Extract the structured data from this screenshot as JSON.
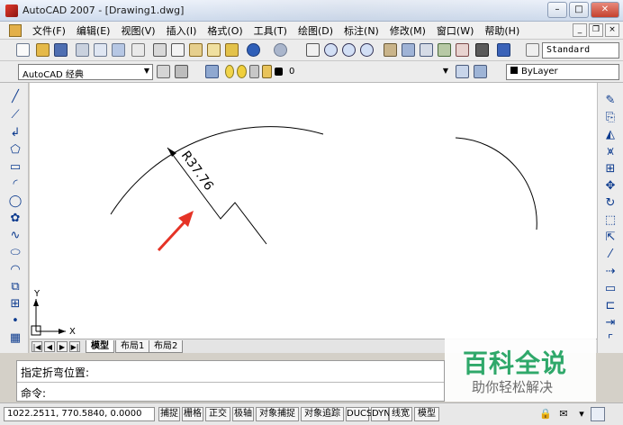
{
  "window": {
    "title": "AutoCAD 2007 - [Drawing1.dwg]",
    "buttons": {
      "minimize": "–",
      "maximize": "□",
      "close": "✕"
    }
  },
  "menubar": {
    "items": [
      "文件(F)",
      "编辑(E)",
      "视图(V)",
      "插入(I)",
      "格式(O)",
      "工具(T)",
      "绘图(D)",
      "标注(N)",
      "修改(M)",
      "窗口(W)",
      "帮助(H)"
    ],
    "mdi_buttons": {
      "minimize": "_",
      "restore": "❐",
      "close": "×"
    }
  },
  "toolbar1": {
    "icons": [
      "new-icon",
      "open-icon",
      "save-icon",
      "plot-icon",
      "plot-preview-icon",
      "publish-icon",
      "cut-icon",
      "copy-icon",
      "paste-icon",
      "matchprop-icon",
      "blockedit-icon",
      "undo-icon",
      "redo-icon",
      "pan-icon",
      "zoom-realtime-icon",
      "zoom-window-icon",
      "zoom-previous-icon",
      "properties-icon",
      "designcenter-icon",
      "toolpalettes-icon",
      "sheetset-icon",
      "markup-icon",
      "calculator-icon",
      "help-icon",
      "text-style-icon"
    ],
    "text_style": "Standard"
  },
  "toolbar2": {
    "workspace": "AutoCAD 经典",
    "layer": "0",
    "color": "ByLayer"
  },
  "left_tools": [
    "line-icon",
    "construction-line-icon",
    "polyline-icon",
    "polygon-icon",
    "rectangle-icon",
    "arc-icon",
    "circle-icon",
    "revision-cloud-icon",
    "spline-icon",
    "ellipse-icon",
    "ellipse-arc-icon",
    "insert-block-icon",
    "make-block-icon",
    "point-icon",
    "hatch-icon"
  ],
  "right_tools": [
    "erase-icon",
    "copy-object-icon",
    "mirror-icon",
    "offset-icon",
    "array-icon",
    "move-icon",
    "rotate-icon",
    "scale-icon",
    "stretch-icon",
    "trim-icon",
    "extend-icon",
    "break-icon",
    "join-icon",
    "chamfer-icon",
    "fillet-icon"
  ],
  "drawing": {
    "dimension_text": "R37.76",
    "ucs_x": "X",
    "ucs_y": "Y"
  },
  "layout_tabs": {
    "nav": [
      "|◀",
      "◀",
      "▶",
      "▶|"
    ],
    "tabs": [
      "模型",
      "布局1",
      "布局2"
    ],
    "active": "模型"
  },
  "command": {
    "history": "指定折弯位置:",
    "prompt": "命令:"
  },
  "watermark": {
    "title": "百科全说",
    "subtitle": "助你轻松解决"
  },
  "status": {
    "coordinates": "1022.2511,  770.5840,  0.0000",
    "toggles": [
      "捕捉",
      "栅格",
      "正交",
      "极轴",
      "对象捕捉",
      "对象追踪",
      "DUCS",
      "DYN",
      "线宽",
      "模型"
    ]
  },
  "colors": {
    "tool_blue": "#0b3a8e",
    "arrow_red": "#e53326",
    "watermark_green": "#2fa86a"
  }
}
